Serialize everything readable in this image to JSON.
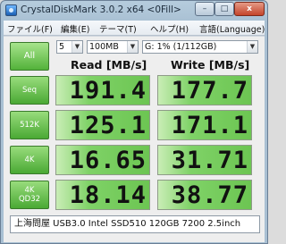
{
  "window": {
    "title": "CrystalDiskMark 3.0.2 x64 <0Fill>",
    "controls": {
      "minimize": "–",
      "maximize": "□",
      "close": "x"
    }
  },
  "menu": [
    {
      "label": "ファイル(F)"
    },
    {
      "label": "編集(E)"
    },
    {
      "label": "テーマ(T)"
    },
    {
      "label": "ヘルプ(H)"
    },
    {
      "label": "言語(Language)"
    }
  ],
  "controls": {
    "all_label": "All",
    "test_count": "5",
    "test_size": "100MB",
    "drive": "G: 1% (1/112GB)"
  },
  "headers": {
    "read": "Read [MB/s]",
    "write": "Write [MB/s]"
  },
  "rows": [
    {
      "label": "Seq",
      "label2": "",
      "read": "191.4",
      "write": "177.7"
    },
    {
      "label": "512K",
      "label2": "",
      "read": "125.1",
      "write": "171.1"
    },
    {
      "label": "4K",
      "label2": "",
      "read": "16.65",
      "write": "31.71"
    },
    {
      "label": "4K",
      "label2": "QD32",
      "read": "18.14",
      "write": "38.77"
    }
  ],
  "comment": "上海問屋 USB3.0 Intel SSD510 120GB 7200 2.5inch",
  "colors": {
    "button_green": "#53b23a",
    "value_green": "#6cc552",
    "frame_blue": "#a9c0d3"
  }
}
